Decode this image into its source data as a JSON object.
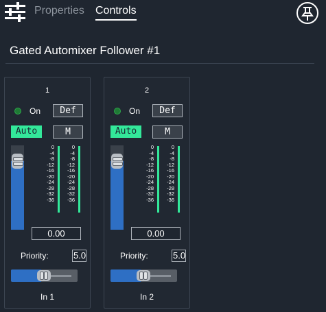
{
  "tabs": [
    {
      "label": "Properties",
      "active": false
    },
    {
      "label": "Controls",
      "active": true
    }
  ],
  "icons": {
    "menu": "sliders-icon",
    "pin": "pin-icon"
  },
  "title": "Gated Automixer Follower #1",
  "colors": {
    "accent": "#33e89a",
    "fader_blue": "#2e6fc4",
    "led_green": "#1f7a35",
    "background": "#1f2630"
  },
  "channels": [
    {
      "number": "1",
      "on_label": "On",
      "def_label": "Def",
      "auto_label": "Auto",
      "m_label": "M",
      "scale": [
        "0",
        "-4",
        "-8",
        "-12",
        "-16",
        "-20",
        "-24",
        "-28",
        "-32",
        "-36"
      ],
      "gain": "0.00",
      "priority_label": "Priority:",
      "priority": "5.00",
      "input_label": "In 1"
    },
    {
      "number": "2",
      "on_label": "On",
      "def_label": "Def",
      "auto_label": "Auto",
      "m_label": "M",
      "scale": [
        "0",
        "-4",
        "-8",
        "-12",
        "-16",
        "-20",
        "-24",
        "-28",
        "-32",
        "-36"
      ],
      "gain": "0.00",
      "priority_label": "Priority:",
      "priority": "5.00",
      "input_label": "In 2"
    }
  ]
}
